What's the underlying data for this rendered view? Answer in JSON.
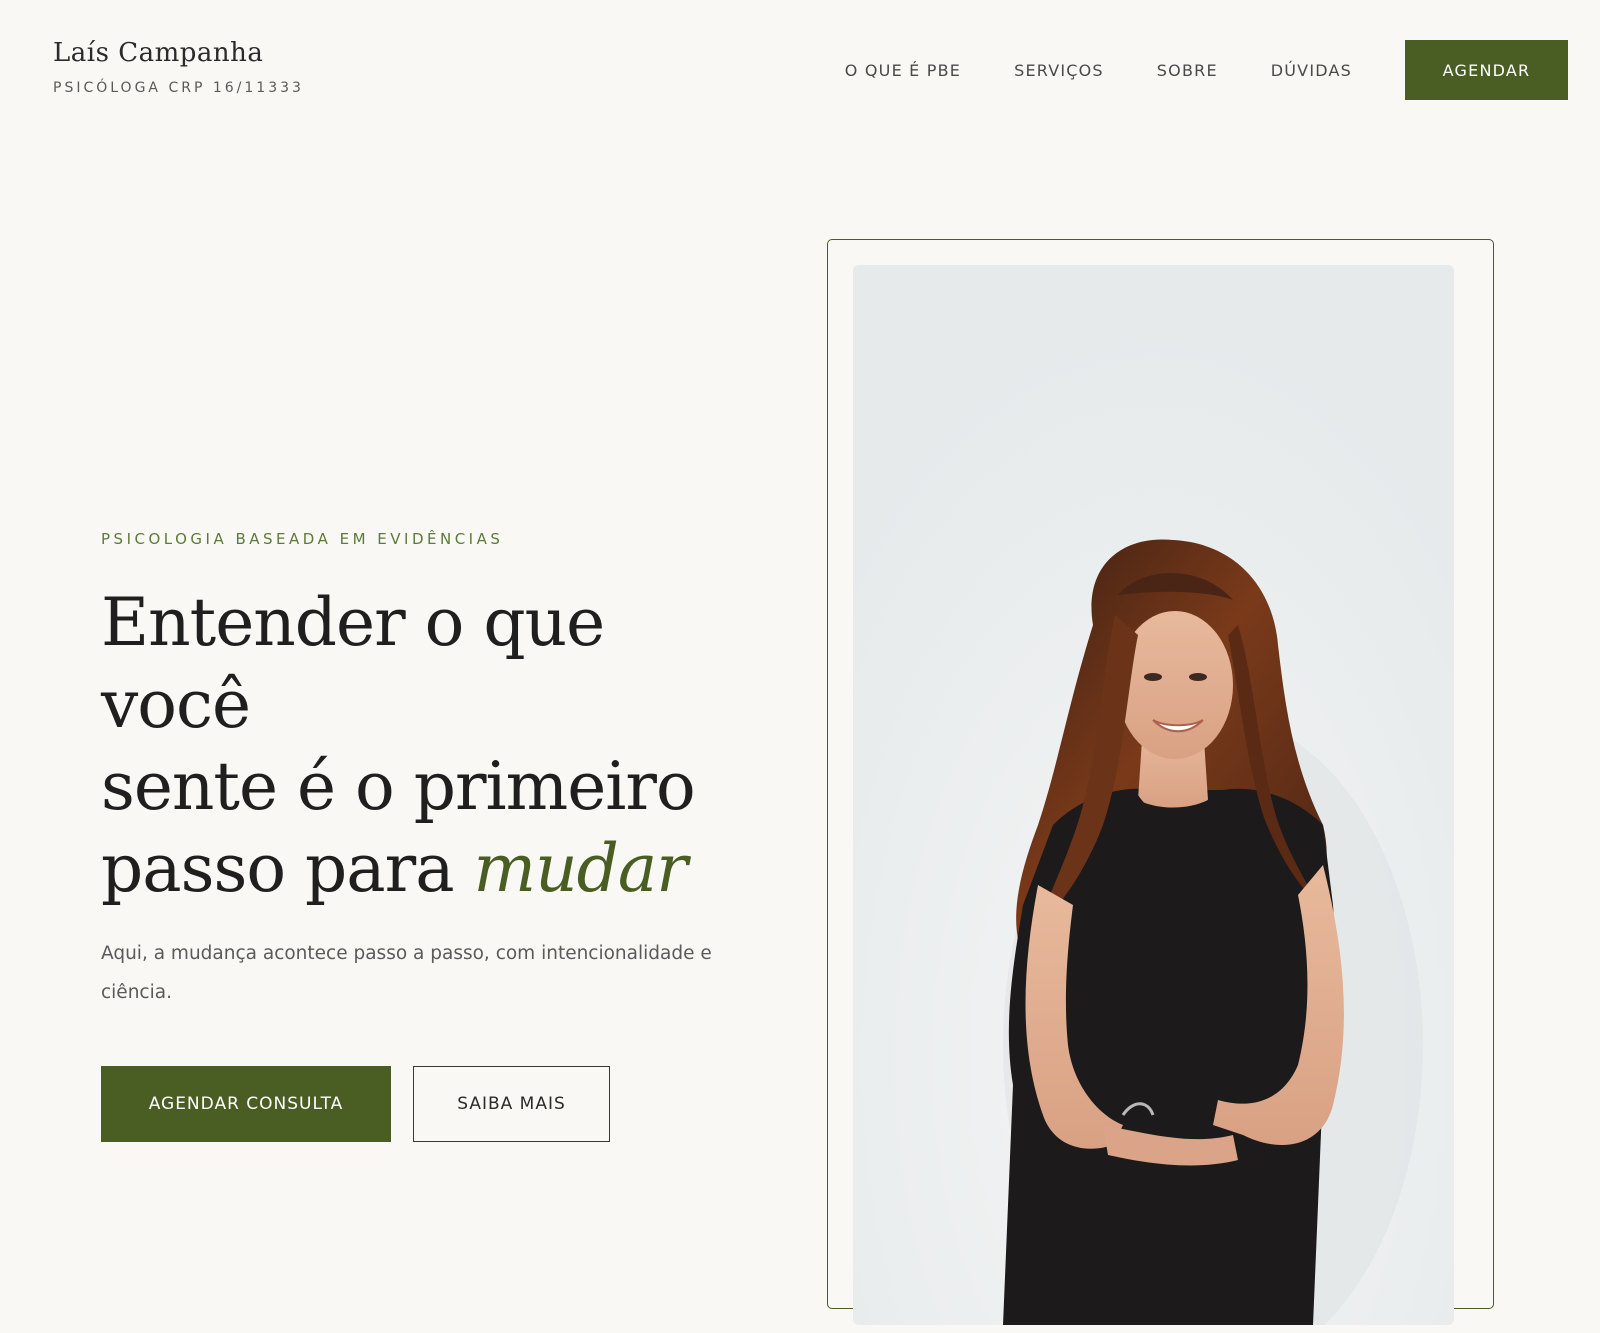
{
  "header": {
    "brand_name": "Laís Campanha",
    "brand_subtitle": "PSICÓLOGA CRP 16/11333",
    "nav": [
      {
        "label": "O QUE É PBE"
      },
      {
        "label": "SERVIÇOS"
      },
      {
        "label": "SOBRE"
      },
      {
        "label": "DÚVIDAS"
      }
    ],
    "cta_label": "AGENDAR"
  },
  "hero": {
    "eyebrow": "PSICOLOGIA BASEADA EM EVIDÊNCIAS",
    "headline_line1": "Entender o que você",
    "headline_line2": "sente é o primeiro",
    "headline_line3_prefix": "passo para ",
    "headline_accent": "mudar",
    "lead": "Aqui, a mudança acontece passo a passo, com intencionalidade e ciência.",
    "primary_button": "AGENDAR CONSULTA",
    "secondary_button": "SAIBA MAIS"
  },
  "colors": {
    "background": "#f9f8f4",
    "accent_green": "#4a5e24",
    "eyebrow_green": "#5e7a3a",
    "text_dark": "#1f1f1f"
  }
}
